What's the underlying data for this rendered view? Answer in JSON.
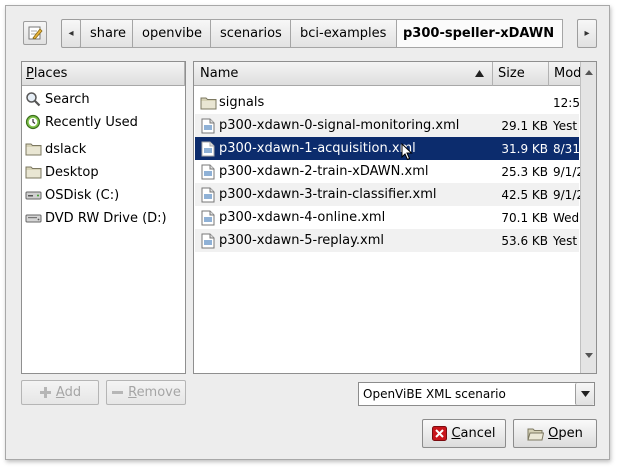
{
  "toolbar": {
    "path_toggle_icon": "pencil-icon",
    "scroll_left_glyph": "◂",
    "scroll_right_glyph": "▸"
  },
  "breadcrumbs": [
    "share",
    "openvibe",
    "scenarios",
    "bci-examples",
    "p300-speller-xDAWN"
  ],
  "places": {
    "header": "Places",
    "header_accel": "P",
    "header_rest": "laces",
    "items": [
      {
        "label": "Search",
        "icon": "search-icon"
      },
      {
        "label": "Recently Used",
        "icon": "recent-icon"
      },
      {
        "label": "dslack",
        "icon": "folder-icon"
      },
      {
        "label": "Desktop",
        "icon": "folder-icon"
      },
      {
        "label": "OSDisk (C:)",
        "icon": "drive-icon"
      },
      {
        "label": "DVD RW Drive (D:)",
        "icon": "dvd-drive-icon"
      }
    ]
  },
  "files": {
    "columns": {
      "name": "Name",
      "size": "Size",
      "modified": "Mod"
    },
    "sort": "ascending",
    "rows": [
      {
        "name": "signals",
        "size": "",
        "modified": "12:5",
        "type": "folder"
      },
      {
        "name": "p300-xdawn-0-signal-monitoring.xml",
        "size": "29.1 KB",
        "modified": "Yest",
        "type": "file"
      },
      {
        "name": "p300-xdawn-1-acquisition.xml",
        "size": "31.9 KB",
        "modified": "8/31",
        "type": "file",
        "selected": true
      },
      {
        "name": "p300-xdawn-2-train-xDAWN.xml",
        "size": "25.3 KB",
        "modified": "9/1/2",
        "type": "file"
      },
      {
        "name": "p300-xdawn-3-train-classifier.xml",
        "size": "42.5 KB",
        "modified": "9/1/2",
        "type": "file"
      },
      {
        "name": "p300-xdawn-4-online.xml",
        "size": "70.1 KB",
        "modified": "Wed",
        "type": "file"
      },
      {
        "name": "p300-xdawn-5-replay.xml",
        "size": "53.6 KB",
        "modified": "Yest",
        "type": "file"
      }
    ]
  },
  "buttons": {
    "add": {
      "accel": "A",
      "rest": "dd"
    },
    "remove": {
      "accel": "R",
      "rest": "emove"
    },
    "cancel": {
      "accel": "C",
      "rest": "ancel"
    },
    "open": {
      "accel": "O",
      "rest": "pen"
    }
  },
  "filter": {
    "selected": "OpenViBE XML scenario"
  },
  "colors": {
    "selection": "#0c2c6d",
    "cancel_icon": "#c8151b",
    "folder": "#c9c4a4"
  }
}
